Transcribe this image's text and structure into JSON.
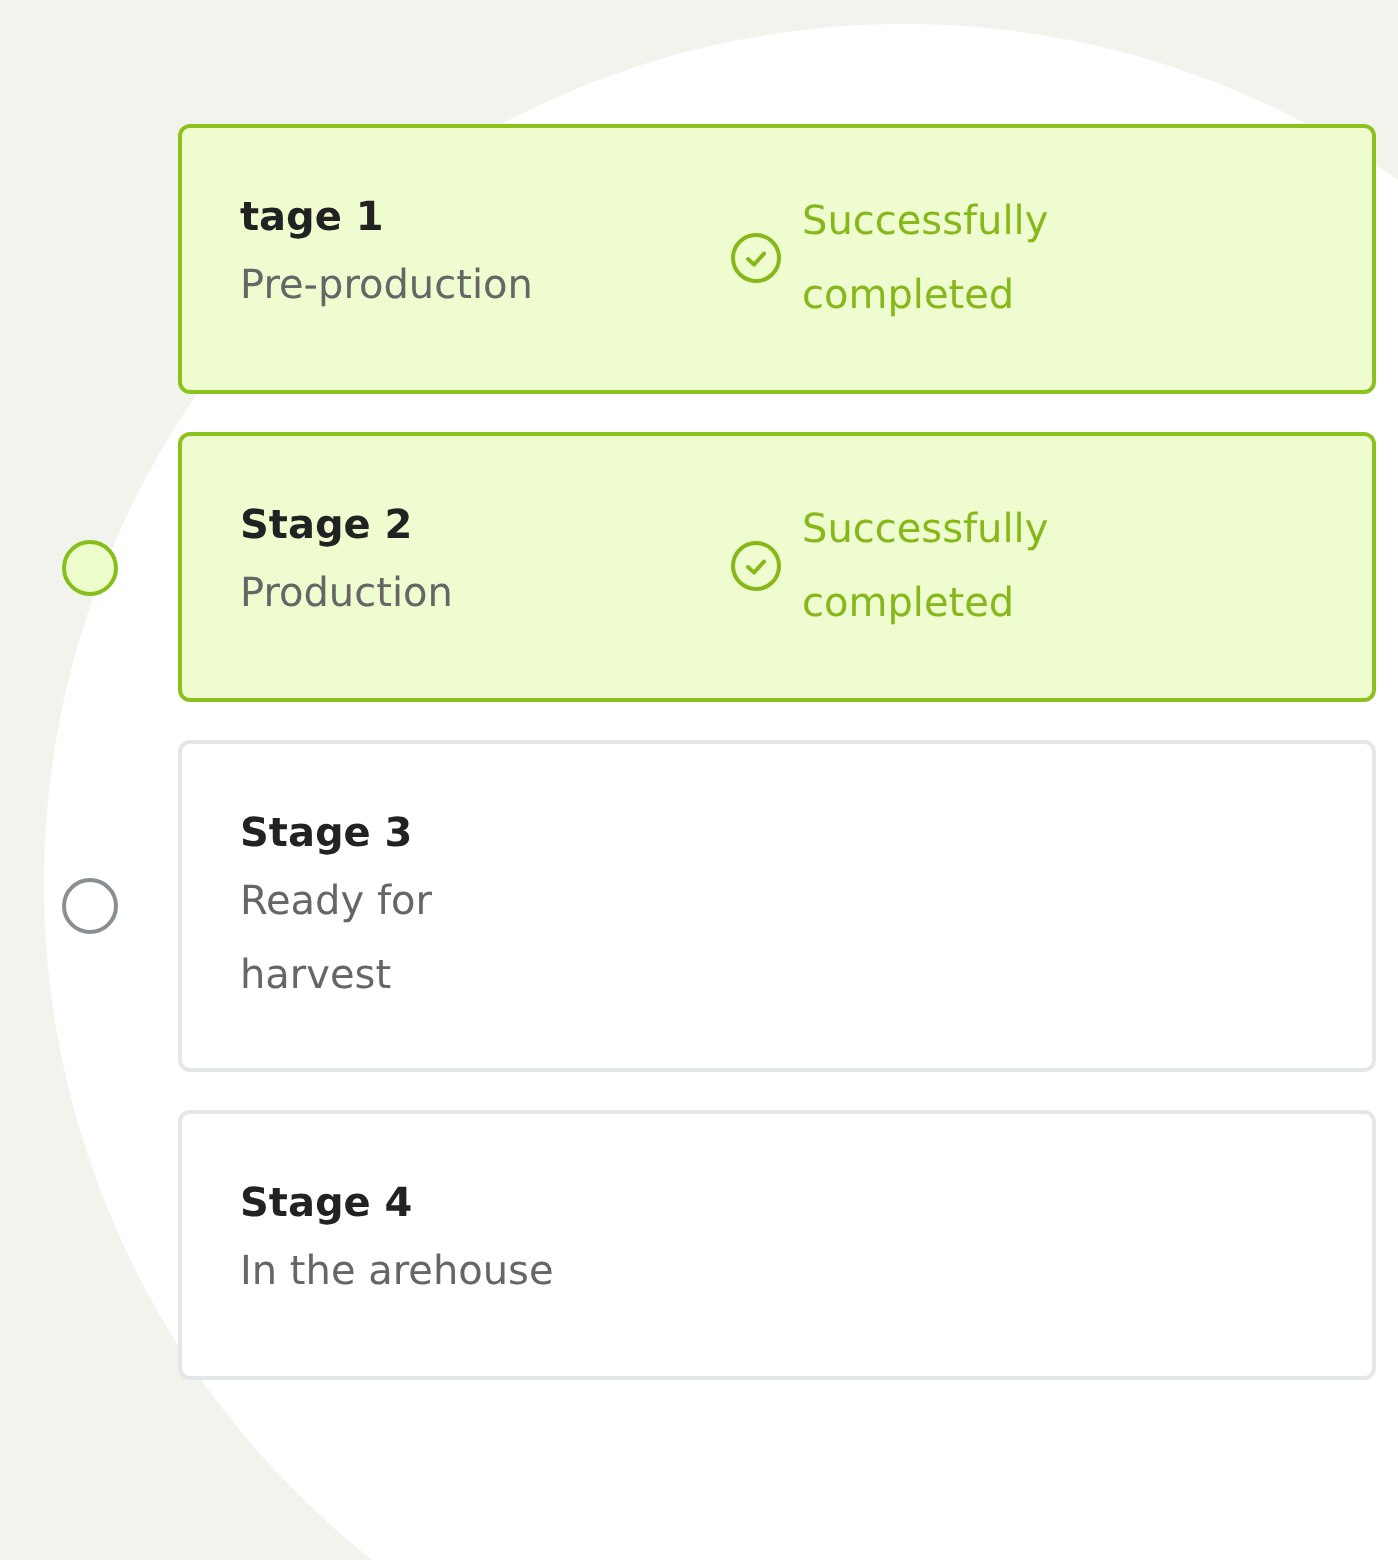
{
  "stages": [
    {
      "title": "tage 1",
      "subtitle": "Pre-production",
      "completed": true,
      "status": "Successfully completed"
    },
    {
      "title": "Stage 2",
      "subtitle": "Production",
      "completed": true,
      "status": "Successfully completed",
      "radio": {
        "active": true
      }
    },
    {
      "title": "Stage 3",
      "subtitle": "Ready for harvest",
      "completed": false,
      "radio": {
        "active": false
      }
    },
    {
      "title": "Stage 4",
      "subtitle": "In the arehouse",
      "completed": false
    }
  ]
}
